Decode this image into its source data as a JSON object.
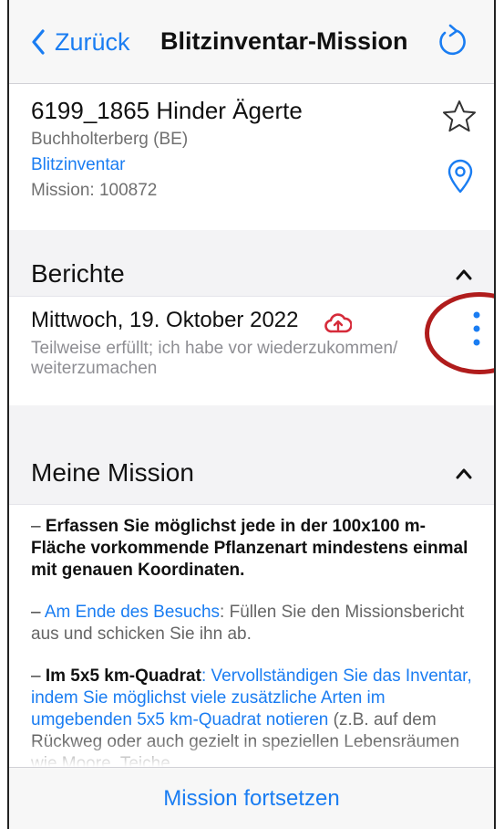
{
  "navbar": {
    "back_label": "Zurück",
    "title": "Blitzinventar-Mission",
    "refresh_icon": "refresh-icon"
  },
  "site": {
    "name": "6199_1865 Hinder Ägerte",
    "location": "Buchholterberg (BE)",
    "type": "Blitzinventar",
    "mission": "Mission: 100872"
  },
  "reports": {
    "title": "Berichte",
    "items": [
      {
        "date": "Mittwoch, 19. Oktober 2022",
        "description": "Teilweise erfüllt; ich habe vor wiederzukommen/ weiterzumachen"
      }
    ]
  },
  "mission": {
    "title": "Meine Mission",
    "items": [
      {
        "dash": "–",
        "text": "Erfassen Sie möglichst jede in der 100x100 m-Fläche vorkommende Pflanzenart mindestens einmal mit genauen Koordinaten."
      },
      {
        "dash": "–",
        "link": "Am Ende des Besuchs",
        "text": ": Füllen Sie den Missionsbericht aus und schicken Sie ihn ab."
      },
      {
        "dash": "–",
        "bold": "Im 5x5 km-Quadrat",
        "colon": ": ",
        "link": "Vervollständigen Sie das Inventar, indem Sie möglichst viele zusätzliche Arten im umgebenden 5x5 km-Quadrat notieren",
        "text": " (z.B. auf dem Rückweg oder auch gezielt in speziellen Lebensräumen wie Moore, Teiche"
      }
    ]
  },
  "footer": {
    "continue_label": "Mission fortsetzen"
  },
  "colors": {
    "accent": "#1a7df2",
    "alert": "#d62b3a",
    "highlight_ring": "#b01c1c"
  }
}
